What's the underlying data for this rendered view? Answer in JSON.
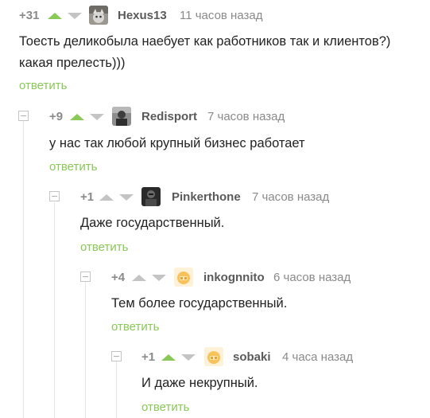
{
  "comments": [
    {
      "rating": "+31",
      "up_active": true,
      "username": "Hexus13",
      "time": "11 часов назад",
      "avatar": "cat-avatar",
      "lines": [
        "Тоесть деликобыла наебует как работников так и клиентов?)",
        "какая прелесть)))"
      ],
      "reply": "ответить"
    },
    {
      "rating": "+9",
      "up_active": true,
      "username": "Redisport",
      "time": "7 часов назад",
      "avatar": "person-avatar",
      "lines": [
        "у нас так любой крупный бизнес работает"
      ],
      "reply": "ответить"
    },
    {
      "rating": "+1",
      "up_active": false,
      "username": "Pinkerthone",
      "time": "7 часов назад",
      "avatar": "dark-avatar",
      "lines": [
        "Даже государственный."
      ],
      "reply": "ответить"
    },
    {
      "rating": "+4",
      "up_active": false,
      "username": "inkognnito",
      "time": "6 часов назад",
      "avatar": "default-avatar",
      "lines": [
        "Тем более государственный."
      ],
      "reply": "ответить"
    },
    {
      "rating": "+1",
      "up_active": true,
      "username": "sobaki",
      "time": "4 часа назад",
      "avatar": "default-avatar",
      "lines": [
        "И даже некрупный."
      ],
      "reply": "ответить"
    }
  ]
}
